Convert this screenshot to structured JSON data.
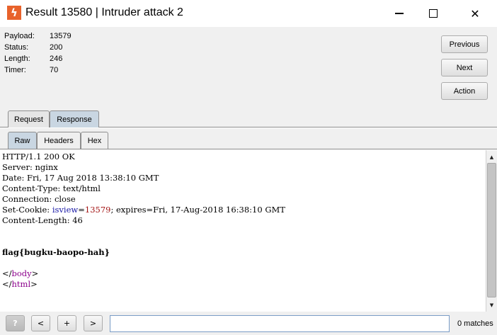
{
  "window": {
    "title": "Result 13580 | Intruder attack 2",
    "icon": "burp-lightning-icon",
    "controls": [
      "minimize",
      "maximize",
      "close"
    ]
  },
  "info": {
    "payload_label": "Payload:",
    "payload_value": "13579",
    "status_label": "Status:",
    "status_value": "200",
    "length_label": "Length:",
    "length_value": "246",
    "timer_label": "Timer:",
    "timer_value": "70"
  },
  "side_buttons": {
    "previous": "Previous",
    "next": "Next",
    "action": "Action"
  },
  "tabs": {
    "request": "Request",
    "response": "Response",
    "active": "Response"
  },
  "subtabs": {
    "raw": "Raw",
    "headers": "Headers",
    "hex": "Hex",
    "active": "Raw"
  },
  "response": {
    "l1": "HTTP/1.1 200 OK",
    "l2": "Server: nginx",
    "l3": "Date: Fri, 17 Aug 2018 13:38:10 GMT",
    "l4": "Content-Type: text/html",
    "l5": "Connection: close",
    "l6_pre": "Set-Cookie: ",
    "l6_key": "isview",
    "l6_eq": "=",
    "l6_val": "13579",
    "l6_post": "; expires=Fri, 17-Aug-2018 16:38:10 GMT",
    "l7": "Content-Length: 46",
    "flag": "flag{bugku-baopo-hah}",
    "body_open": "</",
    "body_tag": "body",
    "body_close": ">",
    "html_open": "</",
    "html_tag": "html",
    "html_close": ">"
  },
  "bottom": {
    "help": "?",
    "prev": "<",
    "add": "+",
    "next": ">",
    "search_value": "",
    "matches": "0 matches"
  },
  "colors": {
    "accent_tab": "#c9d6e2",
    "cookie_key": "#1a1aa6",
    "cookie_val": "#a31515",
    "tag": "#8b008b"
  }
}
